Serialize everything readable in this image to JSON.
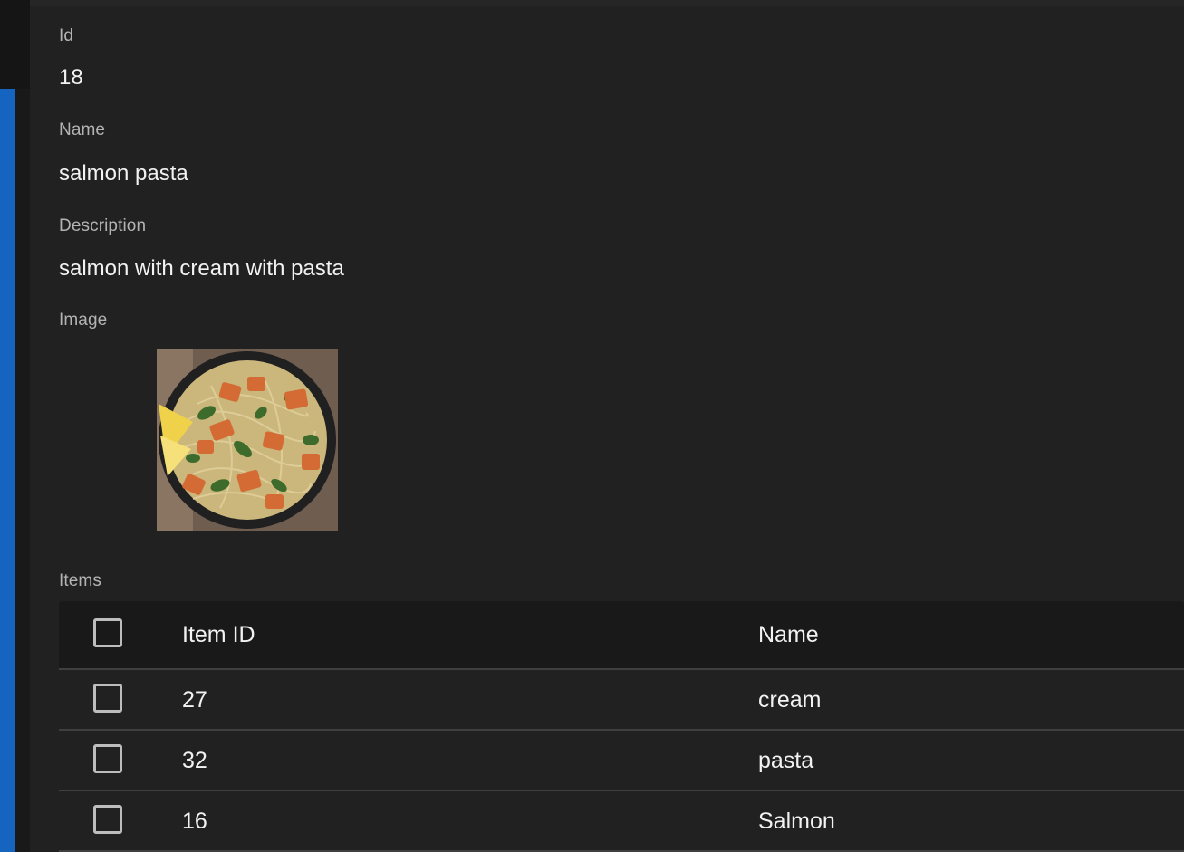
{
  "fields": {
    "id": {
      "label": "Id",
      "value": "18"
    },
    "name": {
      "label": "Name",
      "value": "salmon pasta"
    },
    "description": {
      "label": "Description",
      "value": "salmon with cream with pasta"
    },
    "image": {
      "label": "Image",
      "alt": "salmon pasta"
    }
  },
  "items": {
    "label": "Items",
    "columns": {
      "item_id": "Item ID",
      "name": "Name"
    },
    "rows": [
      {
        "item_id": "27",
        "name": "cream"
      },
      {
        "item_id": "32",
        "name": "pasta"
      },
      {
        "item_id": "16",
        "name": "Salmon"
      }
    ]
  },
  "colors": {
    "background": "#212121",
    "sidebar_accent": "#1565c0",
    "table_header": "#191919",
    "text": "#f2f2f2",
    "label_text": "#b3b3b3"
  }
}
